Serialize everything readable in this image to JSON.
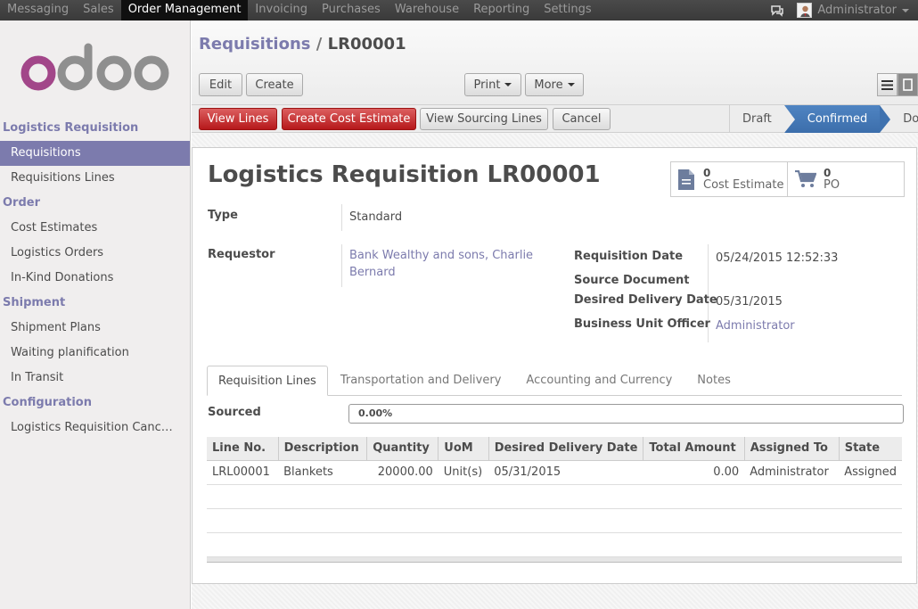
{
  "topbar": {
    "menus": [
      {
        "label": "Messaging"
      },
      {
        "label": "Sales"
      },
      {
        "label": "Order Management"
      },
      {
        "label": "Invoicing"
      },
      {
        "label": "Purchases"
      },
      {
        "label": "Warehouse"
      },
      {
        "label": "Reporting"
      },
      {
        "label": "Settings"
      }
    ],
    "active_menu": "Order Management",
    "user": "Administrator"
  },
  "sidebar": {
    "logo_text": "odoo",
    "sections": [
      {
        "title": "Logistics Requisition",
        "items": [
          "Requisitions",
          "Requisitions Lines"
        ]
      },
      {
        "title": "Order",
        "items": [
          "Cost Estimates",
          "Logistics Orders",
          "In-Kind Donations"
        ]
      },
      {
        "title": "Shipment",
        "items": [
          "Shipment Plans",
          "Waiting planification",
          "In Transit"
        ]
      },
      {
        "title": "Configuration",
        "items": [
          "Logistics Requisition Canc…"
        ]
      }
    ],
    "active_item": "Requisitions"
  },
  "breadcrumb": {
    "parent": "Requisitions",
    "separator": "/",
    "current": "LR00001"
  },
  "toolbar": {
    "edit": "Edit",
    "create": "Create",
    "print": "Print",
    "more": "More"
  },
  "statusbar": {
    "buttons": [
      "View Lines",
      "Create Cost Estimate",
      "View Sourcing Lines",
      "Cancel"
    ],
    "stages": [
      "Draft",
      "Confirmed",
      "Done"
    ],
    "current_stage": "Confirmed"
  },
  "form": {
    "title": "Logistics Requisition LR00001",
    "stats": [
      {
        "value": "0",
        "label": "Cost Estimate",
        "icon": "document-icon"
      },
      {
        "value": "0",
        "label": "PO",
        "icon": "cart-icon"
      }
    ],
    "type_label": "Type",
    "type_value": "Standard",
    "requestor_label": "Requestor",
    "requestor_value": "Bank Wealthy and sons, Charlie Bernard",
    "req_date_label": "Requisition Date",
    "req_date_value": "05/24/2015 12:52:33",
    "source_doc_label": "Source Document",
    "desired_date_label": "Desired Delivery Date",
    "desired_date_value": "05/31/2015",
    "officer_label": "Business Unit Officer",
    "officer_value": "Administrator",
    "tabs": [
      "Requisition Lines",
      "Transportation and Delivery",
      "Accounting and Currency",
      "Notes"
    ],
    "active_tab": "Requisition Lines",
    "sourced_label": "Sourced",
    "sourced_value": "0.00%",
    "sourced_fraction": 0.0
  },
  "lines_table": {
    "columns": [
      "Line No.",
      "Description",
      "Quantity",
      "UoM",
      "Desired Delivery Date",
      "Total Amount",
      "Assigned To",
      "State"
    ],
    "rows": [
      [
        "LRL00001",
        "Blankets",
        "20000.00",
        "Unit(s)",
        "05/31/2015",
        "0.00",
        "Administrator",
        "Assigned"
      ]
    ]
  }
}
